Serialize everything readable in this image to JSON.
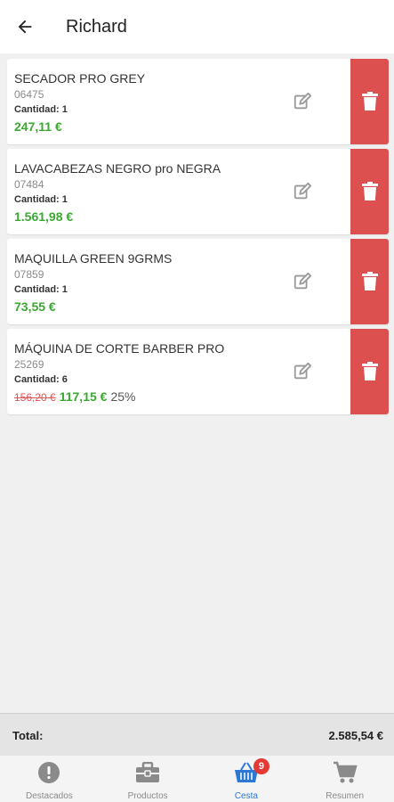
{
  "header": {
    "title": "Richard"
  },
  "items": [
    {
      "name": "SECADOR PRO GREY",
      "code": "06475",
      "quantity": "Cantidad: 1",
      "old_price": "",
      "price": "247,11 €",
      "discount": ""
    },
    {
      "name": "LAVACABEZAS NEGRO pro NEGRA",
      "code": "07484",
      "quantity": "Cantidad: 1",
      "old_price": "",
      "price": "1.561,98 €",
      "discount": ""
    },
    {
      "name": "MAQUILLA GREEN 9GRMS",
      "code": "07859",
      "quantity": "Cantidad: 1",
      "old_price": "",
      "price": "73,55 €",
      "discount": ""
    },
    {
      "name": "MÁQUINA DE CORTE BARBER PRO",
      "code": "25269",
      "quantity": "Cantidad: 6",
      "old_price": "156,20 €",
      "price": "117,15 €",
      "discount": "25%"
    }
  ],
  "total": {
    "label": "Total:",
    "value": "2.585,54 €"
  },
  "nav": {
    "items": [
      {
        "label": "Destacados",
        "icon": "alert-circle-icon"
      },
      {
        "label": "Productos",
        "icon": "briefcase-icon"
      },
      {
        "label": "Cesta",
        "icon": "basket-icon",
        "badge": "9"
      },
      {
        "label": "Resumen",
        "icon": "cart-icon"
      }
    ]
  },
  "colors": {
    "delete": "#dc5050",
    "price": "#3aa831",
    "old_price": "#e05555",
    "active": "#2b78d6",
    "badge": "#e53935"
  }
}
